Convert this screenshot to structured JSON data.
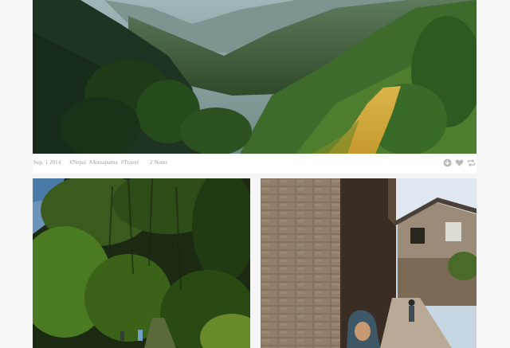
{
  "post": {
    "date": "Sep. 1 2014",
    "tags": [
      "#Nepal",
      "#Annapurna",
      "#Travel"
    ],
    "notes": "2 Notes"
  },
  "icons": {
    "download": "download-icon",
    "like": "heart-icon",
    "reblog": "reblog-icon"
  },
  "colors": {
    "meta_text": "#9a9a9a",
    "icon_gray": "#b8b8b8",
    "background": "#f6f6f6"
  }
}
